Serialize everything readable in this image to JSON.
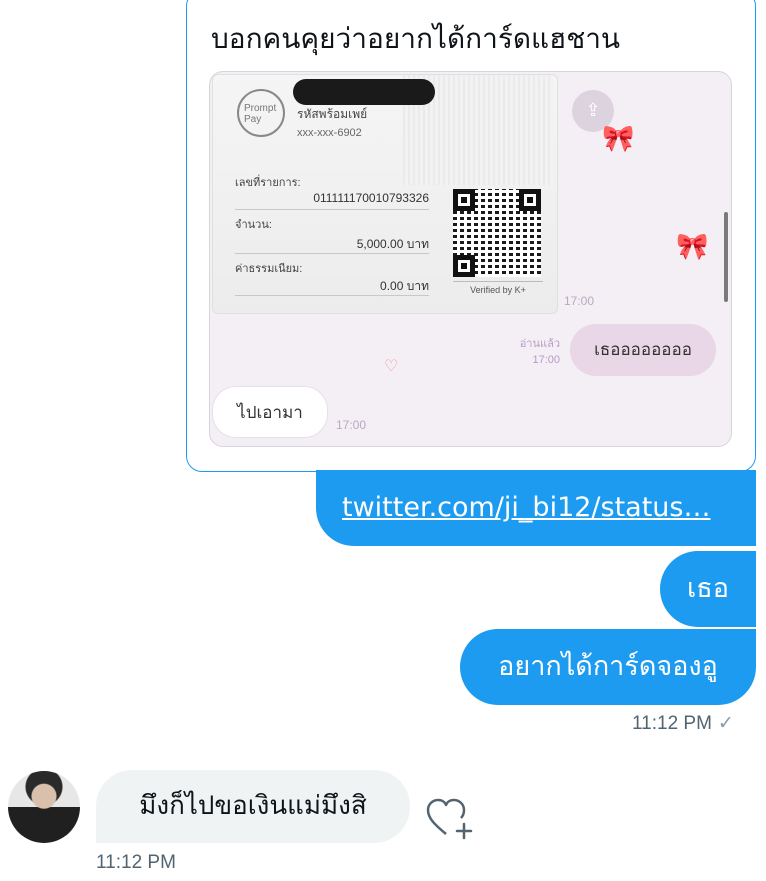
{
  "quoted_tweet": {
    "text": "บอกคนคุยว่าอยากได้การ์ดแฮชาน",
    "media": {
      "slip": {
        "logo_line1": "Prompt",
        "logo_line2": "Pay",
        "account_label": "รหัสพร้อมเพย์",
        "account_number": "xxx-xxx-6902",
        "ref_label": "เลขที่รายการ:",
        "ref_value": "011111170010793326",
        "amount_label": "จำนวน:",
        "amount_value": "5,000.00 บาท",
        "fee_label": "ค่าธรรมเนียม:",
        "fee_value": "0.00 บาท",
        "verified": "Verified by K+"
      },
      "chat": {
        "time_top": "17:00",
        "read_label": "อ่านแล้ว",
        "read_time": "17:00",
        "outgoing_message": "เธออออออออ",
        "incoming_message": "ไปเอามา",
        "incoming_time": "17:00"
      }
    }
  },
  "messages_out": {
    "link": "twitter.com/ji_bi12/status…",
    "short": "เธอ",
    "last": "อยากได้การ์ดจองอู",
    "time": "11:12 PM",
    "status_icon": "✓"
  },
  "message_in": {
    "text": "มึงก็ไปขอเงินแม่มึงสิ",
    "time": "11:12 PM"
  },
  "colors": {
    "accent": "#1d9bf0",
    "incoming_bubble": "#eff3f4",
    "meta_text": "#536471"
  }
}
